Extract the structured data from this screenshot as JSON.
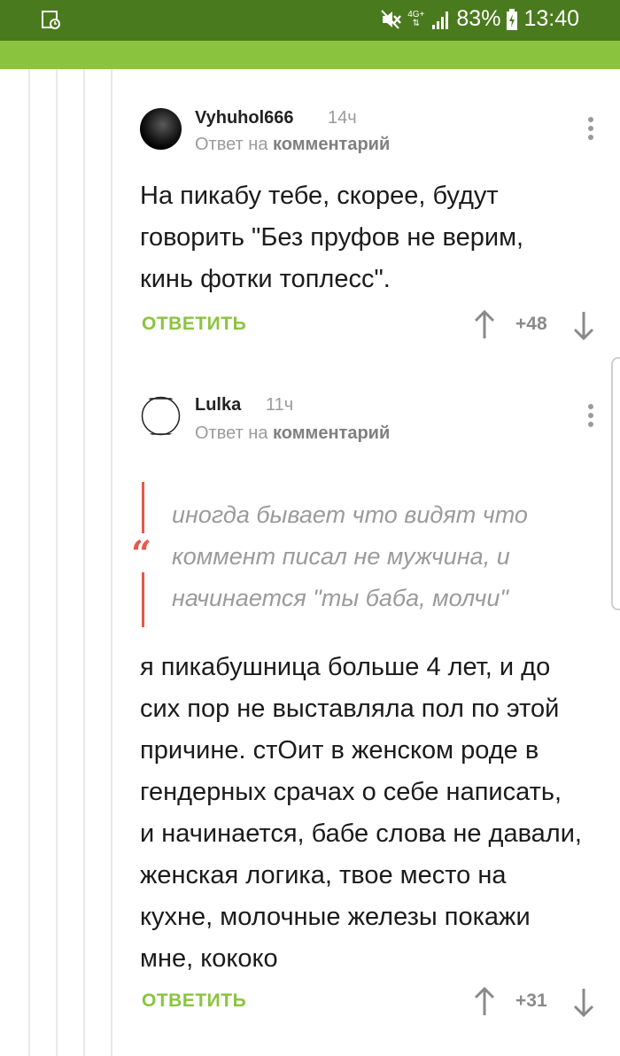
{
  "status_bar": {
    "signal_type": "4G+",
    "battery": "83%",
    "time": "13:40",
    "icons": [
      "gallery-notification-icon",
      "mute-icon",
      "network-icon",
      "signal-icon",
      "battery-charging-icon"
    ]
  },
  "colors": {
    "status_bar": "#4a7a1e",
    "app_bar": "#8ac43f",
    "accent": "#8ac43f",
    "quote_accent": "#e8574a",
    "muted_text": "#9b9b9b"
  },
  "comments": [
    {
      "author": "Vyhuhol666",
      "time": "14ч",
      "reply_prefix": "Ответ на ",
      "reply_link": "комментарий",
      "text": "На пикабу тебе, скорее, будут говорить \"Без пруфов не верим, кинь фотки топлесс\".",
      "reply_label": "ОТВЕТИТЬ",
      "score": "+48"
    },
    {
      "author": "Lulka",
      "time": "11ч",
      "reply_prefix": "Ответ на ",
      "reply_link": "комментарий",
      "quote_mark": "“",
      "quote": "иногда бывает что видят что коммент писал не мужчина, и начинается \"ты баба, молчи\"",
      "text": "я пикабушница больше 4 лет, и до сих пор не выставляла пол по этой причине. стОит в женском роде в гендерных срачах о себе написать, и начинается, бабе слова не давали, женская логика, твое место на кухне, молочные железы покажи мне, кококо",
      "reply_label": "ОТВЕТИТЬ",
      "score": "+31"
    }
  ]
}
